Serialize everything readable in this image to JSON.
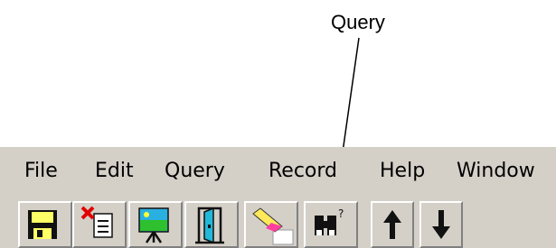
{
  "callout": {
    "label": "Query"
  },
  "menu": {
    "items": [
      {
        "label": "File"
      },
      {
        "label": "Edit"
      },
      {
        "label": "Query"
      },
      {
        "label": "Record"
      },
      {
        "label": "Help"
      },
      {
        "label": "Window"
      }
    ]
  },
  "toolbar": {
    "buttons": [
      {
        "icon": "save-icon"
      },
      {
        "icon": "delete-record-icon"
      },
      {
        "icon": "picture-icon"
      },
      {
        "icon": "exit-door-icon"
      },
      {
        "icon": "eraser-icon"
      },
      {
        "icon": "binoculars-query-icon"
      },
      {
        "icon": "arrow-up-icon"
      },
      {
        "icon": "arrow-down-icon"
      }
    ]
  }
}
